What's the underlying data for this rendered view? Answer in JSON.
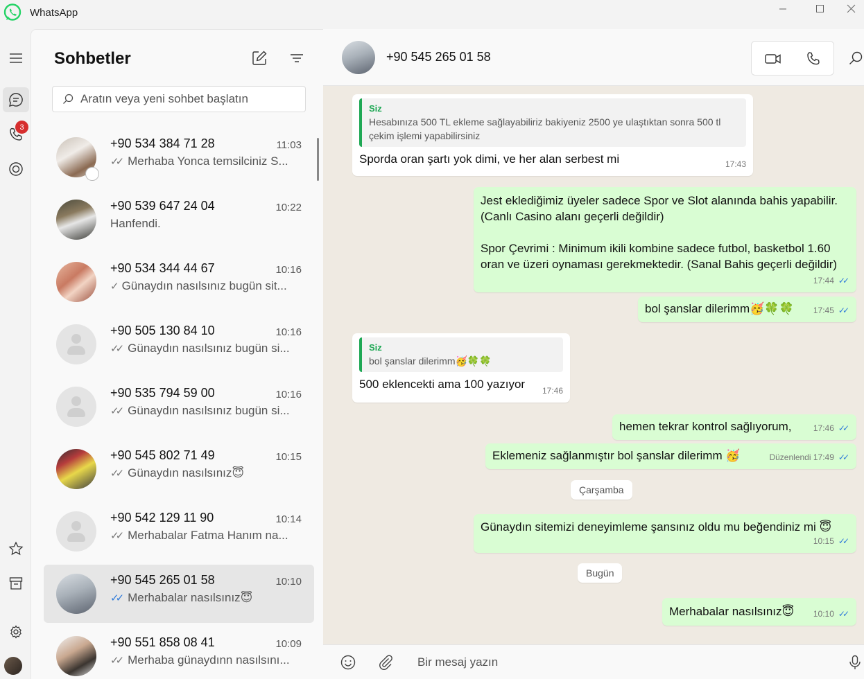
{
  "window": {
    "title": "WhatsApp",
    "brand_color": "#25D366"
  },
  "rail": {
    "calls_badge": "3"
  },
  "chat_list": {
    "title": "Sohbetler",
    "search_placeholder": "Aratın veya yeni sohbet başlatın",
    "chats": [
      {
        "name": "+90 534 384 71 28",
        "time": "11:03",
        "preview": "Merhaba Yonca temsilciniz S...",
        "ticks": "double-grey",
        "avatar": "photo"
      },
      {
        "name": "+90 539 647 24 04",
        "time": "10:22",
        "preview": "Hanfendi.",
        "ticks": "none",
        "avatar": "photo"
      },
      {
        "name": "+90 534 344 44 67",
        "time": "10:16",
        "preview": "Günaydın nasılsınız bugün sit...",
        "ticks": "single",
        "avatar": "photo"
      },
      {
        "name": "+90 505 130 84 10",
        "time": "10:16",
        "preview": "Günaydın nasılsınız bugün si...",
        "ticks": "double-grey",
        "avatar": "default"
      },
      {
        "name": "+90 535 794 59 00",
        "time": "10:16",
        "preview": "Günaydın nasılsınız bugün si...",
        "ticks": "double-grey",
        "avatar": "default"
      },
      {
        "name": "+90 545 802 71 49",
        "time": "10:15",
        "preview": "Günaydın nasılsınız😇",
        "ticks": "double-grey",
        "avatar": "photo"
      },
      {
        "name": "+90 542 129 11 90",
        "time": "10:14",
        "preview": "Merhabalar Fatma Hanım na...",
        "ticks": "double-grey",
        "avatar": "default"
      },
      {
        "name": "+90 545 265 01 58",
        "time": "10:10",
        "preview": "Merhabalar nasılsınız😇",
        "ticks": "double-blue",
        "avatar": "photo",
        "selected": true
      },
      {
        "name": "+90 551 858 08 41",
        "time": "10:09",
        "preview": "Merhaba günaydınn nasılsını...",
        "ticks": "double-grey",
        "avatar": "photo"
      }
    ]
  },
  "conversation": {
    "contact_name": "+90 545 265 01 58",
    "composer_placeholder": "Bir mesaj yazın",
    "messages": [
      {
        "direction": "in",
        "quote_author": "Siz",
        "quote_text": "Hesabınıza 500 TL ekleme sağlayabiliriz bakiyeniz  2500 ye ulaştıktan sonra 500 tl çekim işlemi yapabilirsiniz",
        "text": "Sporda oran şartı yok dimi, ve her alan serbest mi",
        "time": "17:43"
      },
      {
        "direction": "out",
        "text": "Jest eklediğimiz üyeler sadece Spor ve Slot alanında bahis yapabilir. (Canlı Casino alanı geçerli değildir)",
        "text2": "Spor Çevrimi : Minimum ikili kombine sadece futbol, basketbol 1.60 oran ve üzeri oynaması gerekmektedir. (Sanal Bahis geçerli değildir)",
        "time": "17:44"
      },
      {
        "direction": "out",
        "text": "bol şanslar dilerimm🥳🍀🍀",
        "time": "17:45"
      },
      {
        "direction": "in",
        "quote_author": "Siz",
        "quote_text": "bol şanslar dilerimm🥳🍀🍀",
        "text": "500 eklencekti ama 100 yazıyor",
        "time": "17:46"
      },
      {
        "direction": "out",
        "text": "hemen tekrar kontrol sağlıyorum,",
        "time": "17:46"
      },
      {
        "direction": "out",
        "text": "Eklemeniz sağlanmıştır bol şanslar dilerimm  🥳",
        "edited": "Düzenlendi",
        "time": "17:49"
      },
      {
        "direction": "out",
        "text": "Günaydın sitemizi deneyimleme şansınız oldu mu beğendiniz mi 😇",
        "time": "10:15"
      },
      {
        "direction": "out",
        "text": "Merhabalar nasılsınız😇",
        "time": "10:10"
      }
    ],
    "day_separators": [
      "Çarşamba",
      "Bugün"
    ]
  }
}
